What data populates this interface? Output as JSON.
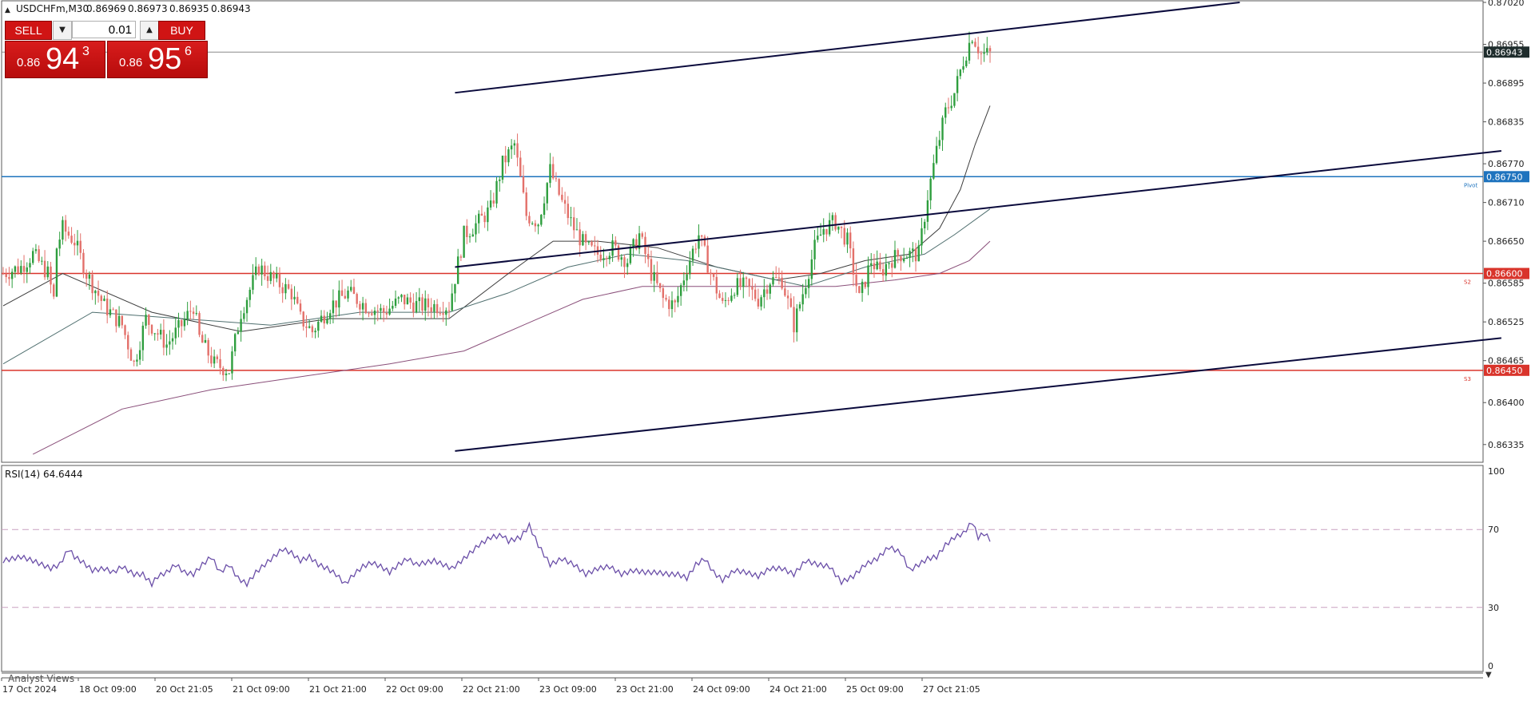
{
  "header": {
    "symbol_label": "USDCHFm,M30",
    "ohlc": [
      "0.86969",
      "0.86973",
      "0.86935",
      "0.86943"
    ]
  },
  "trade_panel": {
    "sell_label": "SELL",
    "buy_label": "BUY",
    "lot_value": "0.01",
    "sell_prefix": "0.86",
    "sell_big": "94",
    "sell_sup": "3",
    "buy_prefix": "0.86",
    "buy_big": "95",
    "buy_sup": "6"
  },
  "colors": {
    "background": "#ffffff",
    "bull": "#2e9e3e",
    "bear": "#e3706a",
    "level_blue": "#1e73be",
    "level_red": "#d9342b",
    "current_price_bg": "#1f2d2d",
    "rsi_line": "#6b4fa8",
    "ma_fast": "#3d3d3d",
    "ma_mid": "#4f6f6f",
    "ma_slow": "#8a4f7a",
    "channel": "#0a0a3c"
  },
  "chart_data": [
    {
      "type": "candlestick",
      "title": "USDCHFm,M30",
      "timeframe": "M30",
      "ylim": [
        0.8631,
        0.8702
      ],
      "y_ticks": [
        "0.87020",
        "0.86955",
        "0.86895",
        "0.86835",
        "0.86770",
        "0.86710",
        "0.86650",
        "0.86585",
        "0.86525",
        "0.86465",
        "0.86400",
        "0.86335"
      ],
      "x_tick_labels": [
        "17 Oct 2024",
        "18 Oct 09:00",
        "20 Oct 21:05",
        "21 Oct 09:00",
        "21 Oct 21:00",
        "22 Oct 09:00",
        "22 Oct 21:00",
        "23 Oct 09:00",
        "23 Oct 21:00",
        "24 Oct 09:00",
        "24 Oct 21:00",
        "25 Oct 09:00",
        "27 Oct 21:05"
      ],
      "current_price": {
        "value": 0.86943,
        "label": "0.86943"
      },
      "levels": [
        {
          "name": "Pivot",
          "value": 0.8675,
          "label": "0.86750",
          "color": "#1e73be"
        },
        {
          "name": "S2",
          "value": 0.866,
          "label": "0.86600",
          "color": "#d9342b"
        },
        {
          "name": "S3",
          "value": 0.8645,
          "label": "0.86450",
          "color": "#d9342b"
        }
      ],
      "close_path": [
        [
          0,
          0.866
        ],
        [
          6,
          0.8661
        ],
        [
          10,
          0.8663
        ],
        [
          15,
          0.866
        ],
        [
          17,
          0.8656
        ],
        [
          18,
          0.8664
        ],
        [
          20,
          0.8667
        ],
        [
          24,
          0.8665
        ],
        [
          28,
          0.866
        ],
        [
          34,
          0.8655
        ],
        [
          40,
          0.8652
        ],
        [
          44,
          0.8646
        ],
        [
          48,
          0.8653
        ],
        [
          55,
          0.8649
        ],
        [
          60,
          0.8652
        ],
        [
          64,
          0.8655
        ],
        [
          66,
          0.865
        ],
        [
          71,
          0.8646
        ],
        [
          76,
          0.8645
        ],
        [
          80,
          0.8654
        ],
        [
          86,
          0.8661
        ],
        [
          91,
          0.8659
        ],
        [
          97,
          0.8657
        ],
        [
          100,
          0.8653
        ],
        [
          104,
          0.8651
        ],
        [
          110,
          0.8655
        ],
        [
          116,
          0.8657
        ],
        [
          122,
          0.8655
        ],
        [
          128,
          0.8654
        ],
        [
          134,
          0.8656
        ],
        [
          140,
          0.8655
        ],
        [
          145,
          0.8655
        ],
        [
          150,
          0.8655
        ],
        [
          155,
          0.8666
        ],
        [
          160,
          0.8668
        ],
        [
          164,
          0.867
        ],
        [
          168,
          0.8677
        ],
        [
          172,
          0.868
        ],
        [
          176,
          0.8669
        ],
        [
          180,
          0.8668
        ],
        [
          184,
          0.8676
        ],
        [
          188,
          0.8671
        ],
        [
          192,
          0.8667
        ],
        [
          196,
          0.8664
        ],
        [
          200,
          0.8663
        ],
        [
          205,
          0.8664
        ],
        [
          210,
          0.8662
        ],
        [
          214,
          0.8666
        ],
        [
          218,
          0.866
        ],
        [
          222,
          0.8656
        ],
        [
          226,
          0.8655
        ],
        [
          230,
          0.8661
        ],
        [
          234,
          0.8666
        ],
        [
          238,
          0.866
        ],
        [
          242,
          0.8655
        ],
        [
          246,
          0.8658
        ],
        [
          250,
          0.8658
        ],
        [
          254,
          0.8656
        ],
        [
          258,
          0.8659
        ],
        [
          262,
          0.8659
        ],
        [
          266,
          0.8652
        ],
        [
          269,
          0.8657
        ],
        [
          273,
          0.8664
        ],
        [
          276,
          0.8667
        ],
        [
          280,
          0.8668
        ],
        [
          284,
          0.8665
        ],
        [
          288,
          0.8656
        ],
        [
          292,
          0.8662
        ],
        [
          295,
          0.866
        ],
        [
          298,
          0.8662
        ],
        [
          302,
          0.8663
        ],
        [
          305,
          0.8663
        ],
        [
          308,
          0.8663
        ],
        [
          311,
          0.8672
        ],
        [
          314,
          0.8679
        ],
        [
          317,
          0.8685
        ],
        [
          320,
          0.8688
        ],
        [
          323,
          0.8693
        ],
        [
          326,
          0.8697
        ],
        [
          329,
          0.8694
        ],
        [
          332,
          0.8694
        ]
      ],
      "overlays": [
        {
          "name": "MA fast",
          "color": "#3d3d3d",
          "path": [
            [
              0,
              0.8655
            ],
            [
              20,
              0.866
            ],
            [
              50,
              0.8654
            ],
            [
              80,
              0.8651
            ],
            [
              110,
              0.8653
            ],
            [
              150,
              0.8653
            ],
            [
              170,
              0.866
            ],
            [
              185,
              0.8665
            ],
            [
              200,
              0.8665
            ],
            [
              220,
              0.8664
            ],
            [
              240,
              0.8661
            ],
            [
              260,
              0.8659
            ],
            [
              275,
              0.866
            ],
            [
              290,
              0.8662
            ],
            [
              305,
              0.8663
            ],
            [
              315,
              0.8667
            ],
            [
              322,
              0.8673
            ],
            [
              327,
              0.868
            ],
            [
              332,
              0.8686
            ]
          ]
        },
        {
          "name": "MA mid",
          "color": "#4f6f6f",
          "path": [
            [
              0,
              0.8646
            ],
            [
              30,
              0.8654
            ],
            [
              60,
              0.8653
            ],
            [
              90,
              0.8652
            ],
            [
              120,
              0.8654
            ],
            [
              150,
              0.8654
            ],
            [
              170,
              0.8657
            ],
            [
              190,
              0.8661
            ],
            [
              210,
              0.8663
            ],
            [
              230,
              0.8662
            ],
            [
              250,
              0.866
            ],
            [
              270,
              0.8658
            ],
            [
              290,
              0.8661
            ],
            [
              310,
              0.8663
            ],
            [
              320,
              0.8666
            ],
            [
              332,
              0.867
            ]
          ]
        },
        {
          "name": "MA slow",
          "color": "#8a4f7a",
          "path": [
            [
              10,
              0.8632
            ],
            [
              40,
              0.8639
            ],
            [
              70,
              0.8642
            ],
            [
              100,
              0.8644
            ],
            [
              130,
              0.8646
            ],
            [
              155,
              0.8648
            ],
            [
              175,
              0.8652
            ],
            [
              195,
              0.8656
            ],
            [
              215,
              0.8658
            ],
            [
              240,
              0.8658
            ],
            [
              260,
              0.8658
            ],
            [
              280,
              0.8658
            ],
            [
              300,
              0.8659
            ],
            [
              315,
              0.866
            ],
            [
              325,
              0.8662
            ],
            [
              332,
              0.8665
            ]
          ]
        }
      ],
      "trendlines": [
        {
          "name": "channel upper",
          "from": [
            152,
            0.8688
          ],
          "to": [
            416,
            0.8702
          ]
        },
        {
          "name": "channel middle",
          "from": [
            152,
            0.8661
          ],
          "to": [
            504,
            0.8679
          ]
        },
        {
          "name": "channel lower",
          "from": [
            152,
            0.86325
          ],
          "to": [
            504,
            0.865
          ]
        }
      ]
    },
    {
      "type": "line",
      "title": "RSI(14) 64.6444",
      "ylim": [
        0,
        100
      ],
      "y_ticks": [
        "100",
        "70",
        "30",
        "0"
      ],
      "levels": [
        70,
        30
      ],
      "series": [
        {
          "name": "RSI(14)",
          "values": [
            [
              0,
              54
            ],
            [
              6,
              56
            ],
            [
              10,
              54
            ],
            [
              16,
              50
            ],
            [
              19,
              52
            ],
            [
              22,
              60
            ],
            [
              24,
              56
            ],
            [
              27,
              53
            ],
            [
              30,
              49
            ],
            [
              34,
              50
            ],
            [
              37,
              48
            ],
            [
              40,
              51
            ],
            [
              44,
              47
            ],
            [
              47,
              47
            ],
            [
              50,
              42
            ],
            [
              52,
              46
            ],
            [
              55,
              48
            ],
            [
              58,
              52
            ],
            [
              61,
              48
            ],
            [
              64,
              47
            ],
            [
              67,
              52
            ],
            [
              70,
              56
            ],
            [
              73,
              48
            ],
            [
              76,
              52
            ],
            [
              79,
              45
            ],
            [
              82,
              42
            ],
            [
              85,
              48
            ],
            [
              88,
              52
            ],
            [
              91,
              56
            ],
            [
              94,
              60
            ],
            [
              97,
              58
            ],
            [
              100,
              54
            ],
            [
              103,
              56
            ],
            [
              106,
              52
            ],
            [
              109,
              50
            ],
            [
              112,
              47
            ],
            [
              115,
              42
            ],
            [
              118,
              47
            ],
            [
              121,
              51
            ],
            [
              124,
              53
            ],
            [
              127,
              51
            ],
            [
              130,
              48
            ],
            [
              133,
              52
            ],
            [
              136,
              55
            ],
            [
              139,
              52
            ],
            [
              142,
              53
            ],
            [
              145,
              54
            ],
            [
              148,
              52
            ],
            [
              151,
              50
            ],
            [
              155,
              55
            ],
            [
              160,
              62
            ],
            [
              164,
              66
            ],
            [
              168,
              67
            ],
            [
              170,
              64
            ],
            [
              174,
              66
            ],
            [
              177,
              72
            ],
            [
              180,
              62
            ],
            [
              184,
              52
            ],
            [
              188,
              55
            ],
            [
              192,
              52
            ],
            [
              196,
              47
            ],
            [
              200,
              50
            ],
            [
              204,
              51
            ],
            [
              208,
              47
            ],
            [
              212,
              49
            ],
            [
              216,
              48
            ],
            [
              220,
              48
            ],
            [
              224,
              47
            ],
            [
              227,
              47
            ],
            [
              230,
              45
            ],
            [
              233,
              52
            ],
            [
              236,
              55
            ],
            [
              239,
              48
            ],
            [
              242,
              44
            ],
            [
              246,
              49
            ],
            [
              250,
              48
            ],
            [
              254,
              46
            ],
            [
              258,
              50
            ],
            [
              262,
              50
            ],
            [
              266,
              47
            ],
            [
              270,
              54
            ],
            [
              274,
              52
            ],
            [
              278,
              51
            ],
            [
              282,
              43
            ],
            [
              286,
              46
            ],
            [
              290,
              52
            ],
            [
              294,
              55
            ],
            [
              298,
              61
            ],
            [
              302,
              58
            ],
            [
              305,
              49
            ],
            [
              308,
              52
            ],
            [
              311,
              55
            ],
            [
              314,
              56
            ],
            [
              317,
              62
            ],
            [
              320,
              66
            ],
            [
              323,
              68
            ],
            [
              326,
              74
            ],
            [
              328,
              66
            ],
            [
              330,
              68
            ],
            [
              332,
              65
            ]
          ]
        }
      ]
    }
  ],
  "footer": {
    "analyst_views_label": "Analyst Views"
  }
}
